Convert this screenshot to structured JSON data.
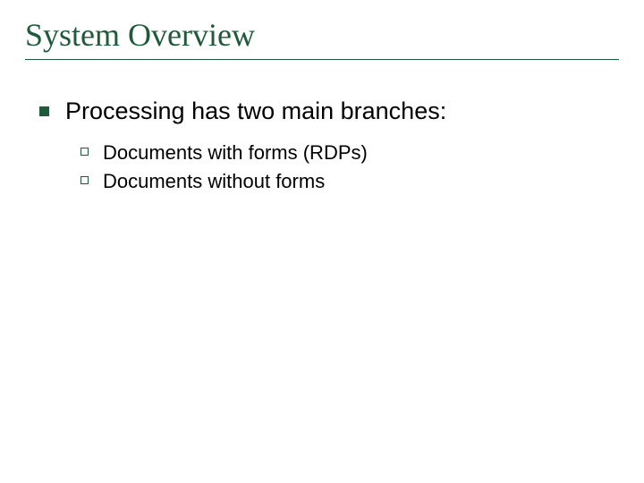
{
  "title": "System Overview",
  "main": {
    "text": "Processing has two main branches:",
    "subitems": [
      {
        "text": "Documents with forms (RDPs)"
      },
      {
        "text": "Documents without forms"
      }
    ]
  }
}
